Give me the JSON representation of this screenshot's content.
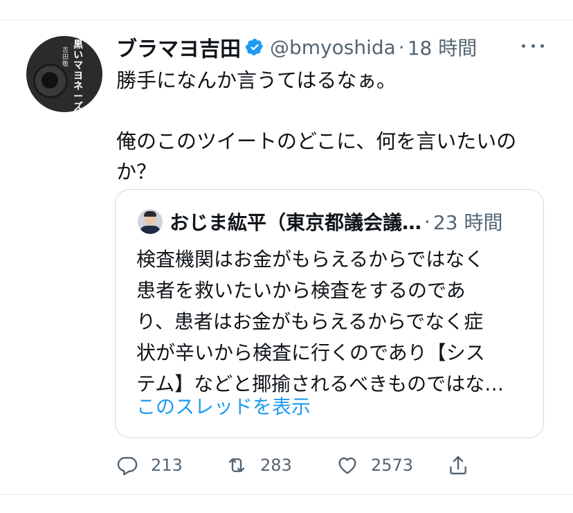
{
  "tweet": {
    "author": {
      "display_name": "ブラマヨ吉田",
      "handle": "@bmyoshida",
      "verified": true,
      "avatar_book_title": "黒いマヨネーズ",
      "avatar_book_author": "吉田 敬"
    },
    "separator": "·",
    "time": "18 時間",
    "text": "勝手になんか言うてはるなぁ。\n\n俺のこのツイートのどこに、何を言いたいの\nか？",
    "quoted": {
      "author_name": "おじま紘平（東京都議会議…",
      "separator": "·",
      "time": "23 時間",
      "text": "検査機関はお金がもらえるからではなく\n患者を救いたいから検査をするのであ\nり、患者はお金がもらえるからでなく症\n状が辛いから検査に行くのであり【シス\nテム】などと揶揄されるべきものではな…",
      "link": "このスレッドを表示"
    },
    "actions": {
      "reply_count": "213",
      "retweet_count": "283",
      "like_count": "2573"
    }
  },
  "colors": {
    "text": "#0f1419",
    "secondary": "#536471",
    "link": "#1d9bf0",
    "verified_badge": "#1d9bf0",
    "border": "#cfd9de"
  },
  "icons": [
    "verified-badge-icon",
    "more-options-icon",
    "reply-icon",
    "retweet-icon",
    "like-icon",
    "share-icon"
  ]
}
